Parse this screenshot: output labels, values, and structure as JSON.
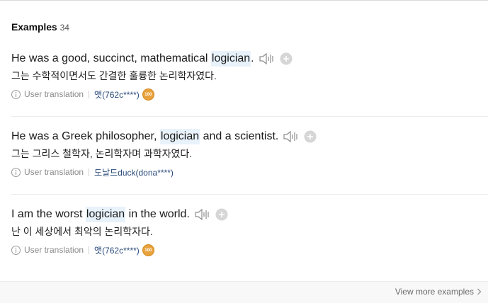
{
  "header": {
    "title": "Examples",
    "count": "34"
  },
  "examples": [
    {
      "before": "He was a good, succinct, mathematical ",
      "highlight": "logician",
      "after": ".",
      "translation": "그는 수학적이면서도 간결한 훌륭한 논리학자였다.",
      "source_label": "User translation",
      "user": "앳(762c****)",
      "badge": "100"
    },
    {
      "before": "He was a Greek philosopher, ",
      "highlight": "logician",
      "after": " and a scientist.",
      "translation": "그는 그리스 철학자, 논리학자며 과학자였다.",
      "source_label": "User translation",
      "user": "도날드duck(dona****)",
      "badge": ""
    },
    {
      "before": "I am the worst ",
      "highlight": "logician",
      "after": " in the world.",
      "translation": "난 이 세상에서 최악의 논리학자다.",
      "source_label": "User translation",
      "user": "앳(762c****)",
      "badge": "100"
    }
  ],
  "footer": {
    "more_label": "View more examples"
  },
  "colors": {
    "highlight_bg": "#e8f2fb",
    "badge": "#e8a23c",
    "user_link": "#2a4a7a"
  },
  "icons": {
    "speaker": "speaker-icon",
    "add": "plus-circle-icon",
    "info": "info-icon",
    "more": "chevron-right-icon"
  }
}
